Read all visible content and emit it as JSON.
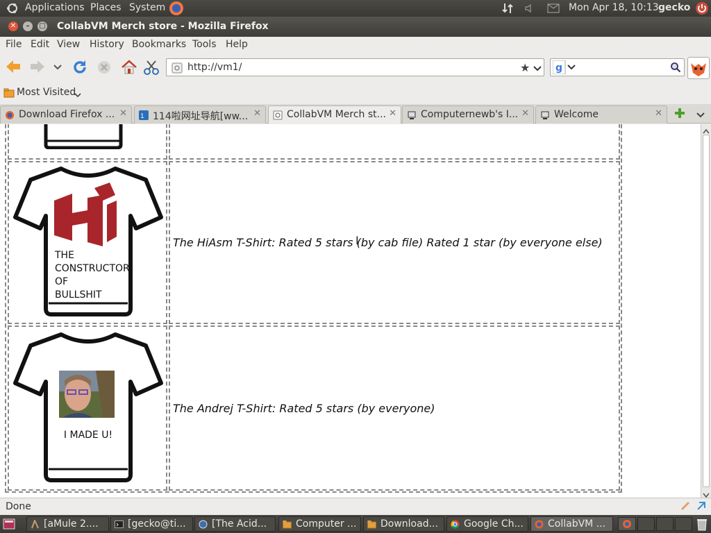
{
  "top_panel": {
    "applications": "Applications",
    "places": "Places",
    "system": "System",
    "datetime": "Mon Apr 18, 10:13",
    "user": "gecko"
  },
  "window": {
    "title": "CollabVM Merch store - Mozilla Firefox"
  },
  "menu": {
    "file": "File",
    "edit": "Edit",
    "view": "View",
    "history": "History",
    "bookmarks": "Bookmarks",
    "tools": "Tools",
    "help": "Help"
  },
  "navbar": {
    "url": "http://vm1/",
    "search_value": ""
  },
  "bookmarks_bar": {
    "most_visited": "Most Visited"
  },
  "tabs": [
    {
      "label": "Download Firefox ...",
      "icon": "firefox-icon"
    },
    {
      "label": "114啦网址导航[ww...",
      "icon": "114-icon"
    },
    {
      "label": "CollabVM Merch st...",
      "icon": "page-icon"
    },
    {
      "label": "Computernewb's I...",
      "icon": "collabvm-icon"
    },
    {
      "label": "Welcome",
      "icon": "collabvm-icon"
    }
  ],
  "content": {
    "products": [
      {
        "shirt_lines": [
          "THE",
          "CONSTRUCTOR",
          "OF",
          "BULLSHIT"
        ],
        "description": "The HiAsm T-Shirt: Rated 5 stars (by cab file) Rated 1 star (by everyone else)"
      },
      {
        "shirt_lines": [
          "I MADE U!"
        ],
        "description": "The Andrej T-Shirt: Rated 5 stars (by everyone)"
      }
    ]
  },
  "status": {
    "text": "Done"
  },
  "taskbar": [
    {
      "label": "[aMule 2....",
      "icon": "amule-icon"
    },
    {
      "label": "[gecko@ti...",
      "icon": "terminal-icon"
    },
    {
      "label": "[The Acid...",
      "icon": "globe-icon"
    },
    {
      "label": "Computer ...",
      "icon": "folder-icon"
    },
    {
      "label": "Download...",
      "icon": "folder-icon"
    },
    {
      "label": "Google Ch...",
      "icon": "chrome-icon"
    },
    {
      "label": "CollabVM ...",
      "icon": "firefox-icon"
    }
  ],
  "colors": {
    "panel": "#3e3d39",
    "accent_orange": "#f07746",
    "link_blue": "#2a6ebb"
  }
}
